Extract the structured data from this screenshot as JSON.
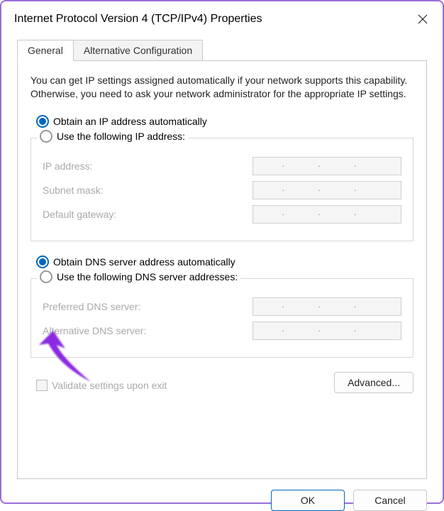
{
  "window": {
    "title": "Internet Protocol Version 4 (TCP/IPv4) Properties"
  },
  "tabs": {
    "general": "General",
    "alternative": "Alternative Configuration"
  },
  "intro": "You can get IP settings assigned automatically if your network supports this capability. Otherwise, you need to ask your network administrator for the appropriate IP settings.",
  "ip": {
    "auto_label": "Obtain an IP address automatically",
    "manual_label": "Use the following IP address:",
    "fields": {
      "address": "IP address:",
      "subnet": "Subnet mask:",
      "gateway": "Default gateway:"
    }
  },
  "dns": {
    "auto_label": "Obtain DNS server address automatically",
    "manual_label": "Use the following DNS server addresses:",
    "fields": {
      "preferred": "Preferred DNS server:",
      "alternative": "Alternative DNS server:"
    }
  },
  "validate_label": "Validate settings upon exit",
  "buttons": {
    "advanced": "Advanced...",
    "ok": "OK",
    "cancel": "Cancel"
  },
  "placeholder_dots": ".     .     ."
}
